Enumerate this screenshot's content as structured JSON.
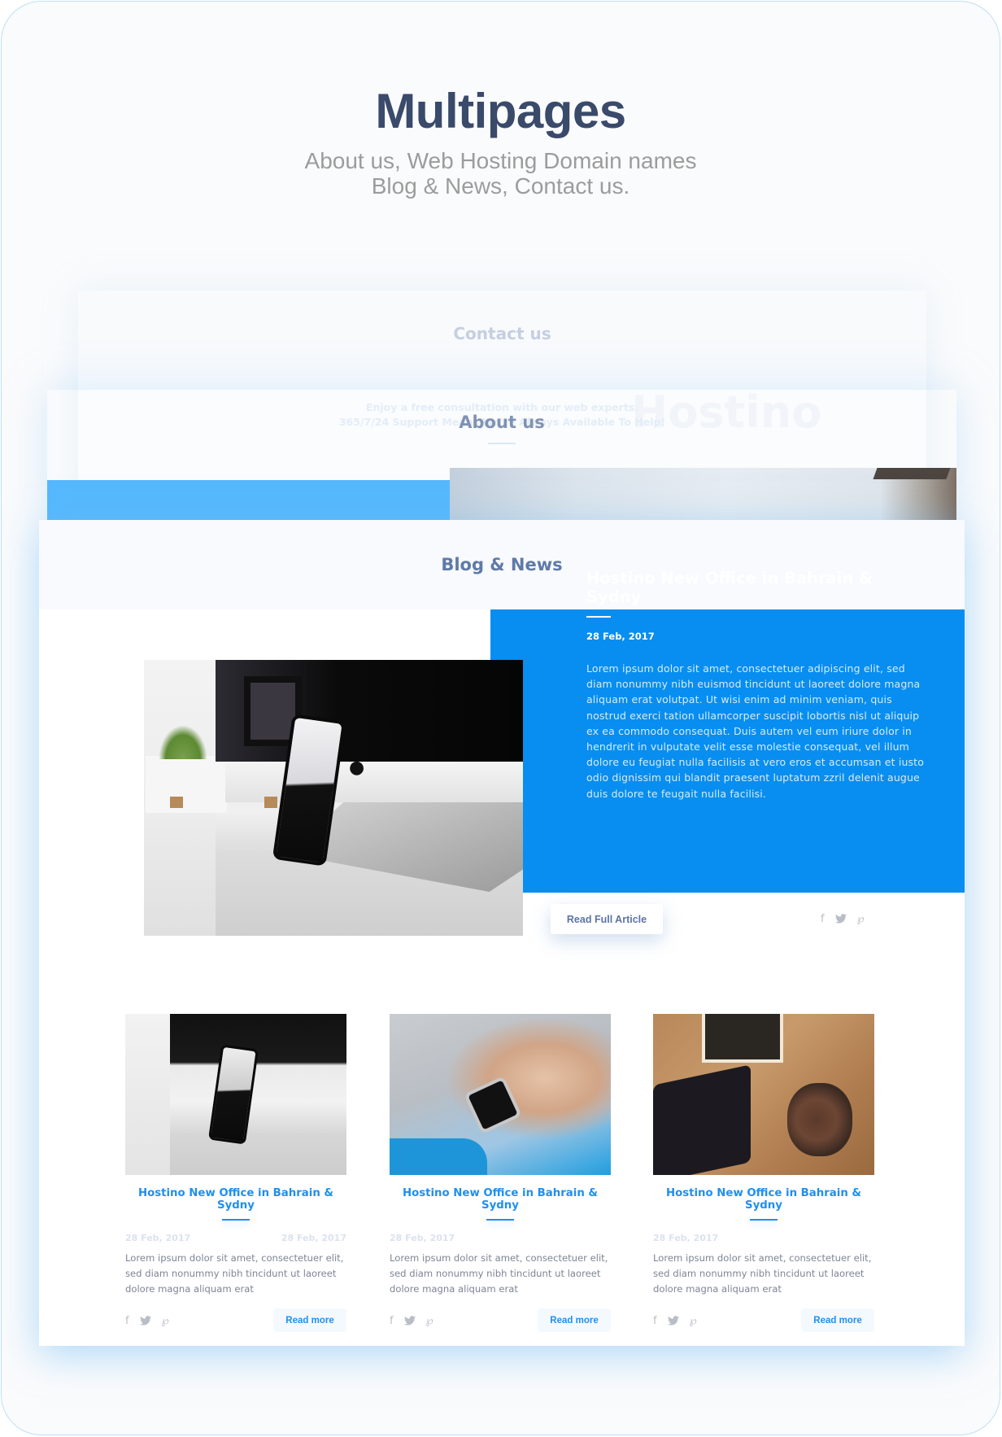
{
  "hero": {
    "title": "Multipages",
    "subtitle_line1": "About us, Web Hosting Domain names",
    "subtitle_line2": "Blog & News, Contact us."
  },
  "layers": {
    "contact": {
      "title": "Contact us",
      "ghost_line1": "Enjoy a free consultation with our web experts.",
      "ghost_line2": "365/7/24 Support Means We're Always Available To Help!",
      "ghost_brand": "Hostino"
    },
    "about": {
      "title": "About us"
    },
    "blog": {
      "title": "Blog & News"
    }
  },
  "featured": {
    "title": "Hostino New Office in Bahrain & Sydny",
    "date": "28 Feb, 2017",
    "text": "Lorem ipsum dolor sit amet, consectetuer adipiscing elit, sed diam nonummy nibh euismod tincidunt ut laoreet dolore magna aliquam erat volutpat. Ut wisi enim ad minim veniam, quis nostrud exerci tation ullamcorper suscipit lobortis nisl ut aliquip ex ea commodo consequat. Duis autem vel eum iriure dolor in hendrerit in vulputate velit esse molestie consequat, vel illum dolore eu feugiat nulla facilisis at vero eros et accumsan et iusto odio dignissim qui blandit praesent luptatum zzril delenit augue duis dolore te feugait nulla facilisi.",
    "button_label": "Read Full Article",
    "panel_color": "#078ef0"
  },
  "social_icons": {
    "facebook": "f",
    "twitter": "🐦",
    "pinterest": "℘"
  },
  "cards": [
    {
      "image": "desk-imac-iphone",
      "title": "Hostino New Office in Bahrain & Sydny",
      "date_left": "28 Feb, 2017",
      "date_right": "28 Feb, 2017",
      "text": "Lorem ipsum dolor sit amet, consectetuer elit, sed diam nonummy nibh tincidunt ut laoreet dolore magna aliquam erat",
      "button_label": "Read more"
    },
    {
      "image": "smartwatch-wrist",
      "title": "Hostino New Office in Bahrain & Sydny",
      "date_left": "28 Feb, 2017",
      "date_right": "",
      "text": "Lorem ipsum dolor sit amet, consectetuer elit, sed diam nonummy nibh tincidunt ut laoreet dolore magna aliquam erat",
      "button_label": "Read more"
    },
    {
      "image": "tablet-headphones",
      "title": "Hostino New Office in Bahrain & Sydny",
      "date_left": "28 Feb, 2017",
      "date_right": "",
      "text": "Lorem ipsum dolor sit amet, consectetuer elit, sed diam nonummy nibh tincidunt ut laoreet dolore magna aliquam erat",
      "button_label": "Read more"
    }
  ],
  "colors": {
    "title": "#3a4a6b",
    "accent": "#1f8ff0",
    "about_bar": "#56b8fd"
  }
}
